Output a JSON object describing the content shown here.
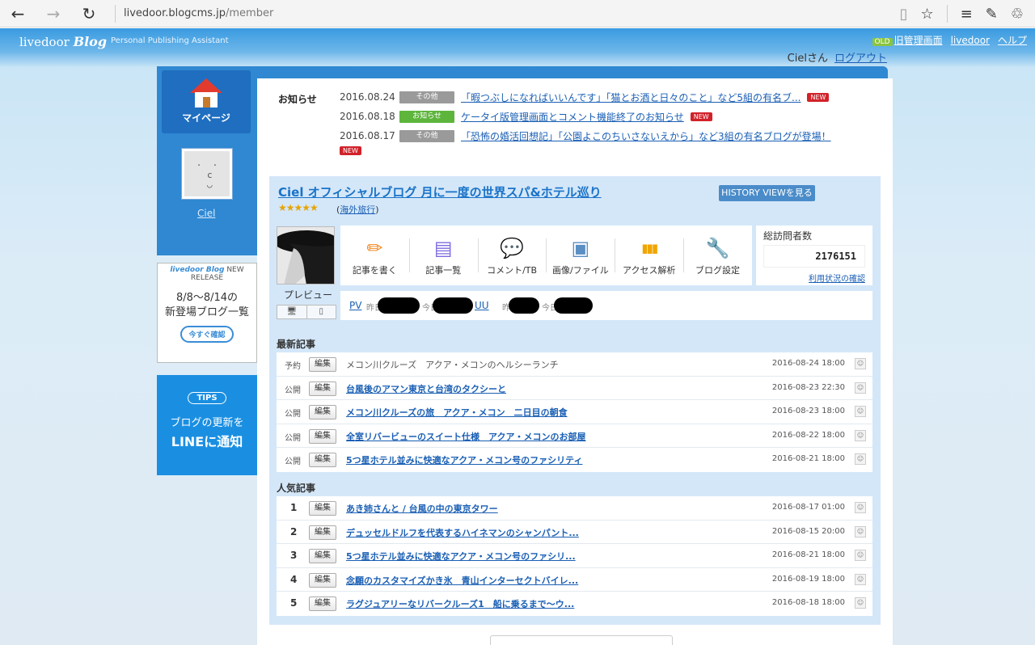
{
  "browser": {
    "url_host": "livedoor.blogcms.jp",
    "url_path": "/member",
    "back_icon": "←",
    "forward_icon": "→",
    "reload_icon": "↻",
    "reader_icon": "▯",
    "favorite_icon": "☆",
    "hub_icon": "≡",
    "note_icon": "✎",
    "share_icon": "♲"
  },
  "header": {
    "logo_text": "livedoor",
    "logo_blog": "Blog",
    "tagline": "Personal Publishing Assistant",
    "old_badge": "OLD",
    "links": [
      "旧管理画面",
      "livedoor",
      "ヘルプ"
    ],
    "user_name": "Cielさん",
    "logout": "ログアウト"
  },
  "sidebar": {
    "mypage_label": "マイページ",
    "avatar_face": "·  ·\n c\n ◡",
    "profile_link": "Ciel",
    "banner1": {
      "head_brand": "livedoor Blog",
      "head_tag": "NEW RELEASE",
      "line1": "8/8〜8/14の",
      "line2": "新登場ブログ一覧",
      "button": "今すぐ確認"
    },
    "banner2": {
      "tips": "TIPS",
      "line1": "ブログの更新を",
      "line2": "LINEに通知"
    }
  },
  "news": {
    "label": "お知らせ",
    "new_label": "NEW",
    "items": [
      {
        "date": "2016.08.24",
        "category": "その他",
        "title": "「暇つぶしになればいいんです」「猫とお酒と日々のこと」など5組の有名ブ..."
      },
      {
        "date": "2016.08.18",
        "category": "お知らせ",
        "title": "ケータイ版管理画面とコメント機能終了のお知らせ"
      },
      {
        "date": "2016.08.17",
        "category": "その他",
        "title": "「恐怖の婚活回想記」「公園よこのちいさないえから」など3組の有名ブログが登場！"
      }
    ]
  },
  "blog": {
    "title": "Ciel オフィシャルブログ 月に一度の世界スパ&ホテル巡り",
    "history_button": "HISTORY VIEWを見る",
    "stars": "★★★★★",
    "rating": 5,
    "category": "海外旅行",
    "preview_label": "プレビュー",
    "preview_pc_icon": "🖥",
    "preview_mobile_icon": "▯",
    "tools": [
      {
        "label": "記事を書く",
        "icon": "pencil-icon",
        "glyph": "✏",
        "color": "#f08a24"
      },
      {
        "label": "記事一覧",
        "icon": "document-icon",
        "glyph": "▤",
        "color": "#7d6be0"
      },
      {
        "label": "コメント/TB",
        "icon": "comment-icon",
        "glyph": "💬",
        "color": "#3aa64a"
      },
      {
        "label": "画像/ファイル",
        "icon": "image-icon",
        "glyph": "▣",
        "color": "#5a8fc4"
      },
      {
        "label": "アクセス解析",
        "icon": "bar-chart-icon",
        "glyph": "▮▮▮",
        "color": "#f0a500"
      },
      {
        "label": "ブログ設定",
        "icon": "wrench-icon",
        "glyph": "🔧",
        "color": "#e0507a"
      }
    ],
    "visits_label": "総訪問者数",
    "visits_count": "2176151",
    "usage_link": "利用状況の確認",
    "pv_label": "PV",
    "uu_label": "UU",
    "yesterday": "昨日",
    "today": "今日"
  },
  "latest": {
    "label": "最新記事",
    "edit_label": "編集",
    "rows": [
      {
        "status": "予約",
        "title": "メコン川クルーズ　アクア・メコンのヘルシーランチ",
        "date": "2016-08-24 18:00",
        "link": false
      },
      {
        "status": "公開",
        "title": "台風後のアマン東京と台湾のタクシーと",
        "date": "2016-08-23 22:30",
        "link": true
      },
      {
        "status": "公開",
        "title": "メコン川クルーズの旅　アクア・メコン　二日目の朝食",
        "date": "2016-08-23 18:00",
        "link": true
      },
      {
        "status": "公開",
        "title": "全室リバービューのスイート仕様　アクア・メコンのお部屋",
        "date": "2016-08-22 18:00",
        "link": true
      },
      {
        "status": "公開",
        "title": "5つ星ホテル並みに快適なアクア・メコン号のファシリティ",
        "date": "2016-08-21 18:00",
        "link": true
      }
    ]
  },
  "popular": {
    "label": "人気記事",
    "edit_label": "編集",
    "rows": [
      {
        "rank": "1",
        "title": "あき姉さんと / 台風の中の東京タワー",
        "date": "2016-08-17 01:00"
      },
      {
        "rank": "2",
        "title": "デュッセルドルフを代表するハイネマンのシャンパント...",
        "date": "2016-08-15 20:00"
      },
      {
        "rank": "3",
        "title": "5つ星ホテル並みに快適なアクア・メコン号のファシリ...",
        "date": "2016-08-21 18:00"
      },
      {
        "rank": "4",
        "title": "念願のカスタマイズかき氷　青山インターセクトバイレ...",
        "date": "2016-08-19 18:00"
      },
      {
        "rank": "5",
        "title": "ラグジュアリーなリバークルーズ1　船に乗るまで〜ウ...",
        "date": "2016-08-18 18:00"
      }
    ]
  }
}
